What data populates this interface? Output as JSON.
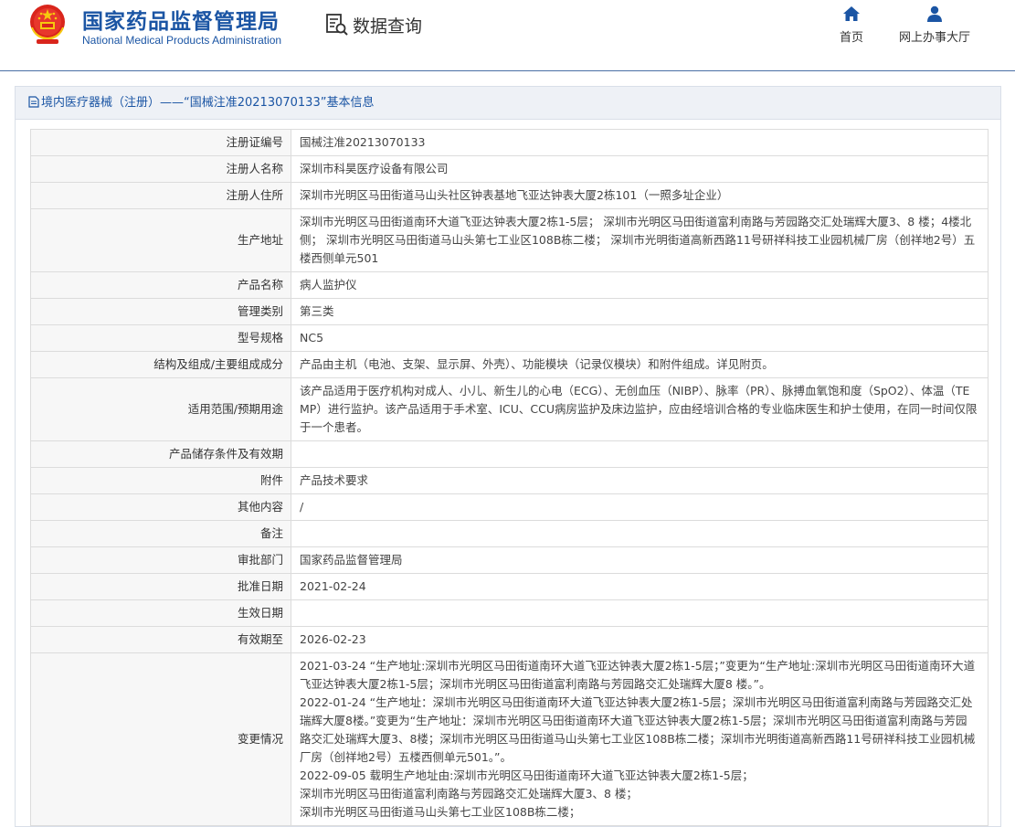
{
  "header": {
    "brand_cn": "国家药品监督管理局",
    "brand_en": "National Medical Products Administration",
    "query_label": "数据查询",
    "nav": {
      "home": "首页",
      "hall": "网上办事大厅"
    }
  },
  "panel": {
    "title": "境内医疗器械（注册）——“国械注准20213070133”基本信息"
  },
  "colors": {
    "brand_blue": "#1b55a4",
    "label_bg": "#f7f7f7",
    "title_bg": "#eef1f6"
  },
  "rows": [
    {
      "label": "注册证编号",
      "value": "国械注准20213070133"
    },
    {
      "label": "注册人名称",
      "value": "深圳市科昊医疗设备有限公司"
    },
    {
      "label": "注册人住所",
      "value": "深圳市光明区马田街道马山头社区钟表基地飞亚达钟表大厦2栋101（一照多址企业）"
    },
    {
      "label": "生产地址",
      "value": "深圳市光明区马田街道南环大道飞亚达钟表大厦2栋1-5层； 深圳市光明区马田街道富利南路与芳园路交汇处瑞辉大厦3、8 楼；4楼北侧； 深圳市光明区马田街道马山头第七工业区108B栋二楼； 深圳市光明街道高新西路11号研祥科技工业园机械厂房（创祥地2号）五楼西侧单元501"
    },
    {
      "label": "产品名称",
      "value": "病人监护仪"
    },
    {
      "label": "管理类别",
      "value": "第三类"
    },
    {
      "label": "型号规格",
      "value": "NC5"
    },
    {
      "label": "结构及组成/主要组成成分",
      "value": "产品由主机（电池、支架、显示屏、外壳）、功能模块（记录仪模块）和附件组成。详见附页。"
    },
    {
      "label": "适用范围/预期用途",
      "value": "该产品适用于医疗机构对成人、小儿、新生儿的心电（ECG）、无创血压（NIBP）、脉率（PR）、脉搏血氧饱和度（SpO2）、体温（TEMP）进行监护。该产品适用于手术室、ICU、CCU病房监护及床边监护，应由经培训合格的专业临床医生和护士使用，在同一时间仅限于一个患者。"
    },
    {
      "label": "产品储存条件及有效期",
      "value": ""
    },
    {
      "label": "附件",
      "value": "产品技术要求"
    },
    {
      "label": "其他内容",
      "value": "/"
    },
    {
      "label": "备注",
      "value": ""
    },
    {
      "label": "审批部门",
      "value": "国家药品监督管理局"
    },
    {
      "label": "批准日期",
      "value": "2021-02-24"
    },
    {
      "label": "生效日期",
      "value": ""
    },
    {
      "label": "有效期至",
      "value": "2026-02-23"
    },
    {
      "label": "变更情况",
      "value": "2021-03-24 “生产地址:深圳市光明区马田街道南环大道飞亚达钟表大厦2栋1-5层；”变更为“生产地址:深圳市光明区马田街道南环大道飞亚达钟表大厦2栋1-5层；深圳市光明区马田街道富利南路与芳园路交汇处瑞辉大厦8 楼。”。\n2022-01-24 “生产地址：深圳市光明区马田街道南环大道飞亚达钟表大厦2栋1-5层；深圳市光明区马田街道富利南路与芳园路交汇处瑞辉大厦8楼。”变更为“生产地址：深圳市光明区马田街道南环大道飞亚达钟表大厦2栋1-5层；深圳市光明区马田街道富利南路与芳园路交汇处瑞辉大厦3、8楼；深圳市光明区马田街道马山头第七工业区108B栋二楼；深圳市光明街道高新西路11号研祥科技工业园机械厂房（创祥地2号）五楼西侧单元501。”。\n2022-09-05 载明生产地址由:深圳市光明区马田街道南环大道飞亚达钟表大厦2栋1-5层；\n深圳市光明区马田街道富利南路与芳园路交汇处瑞辉大厦3、8 楼；\n深圳市光明区马田街道马山头第七工业区108B栋二楼；"
    }
  ]
}
